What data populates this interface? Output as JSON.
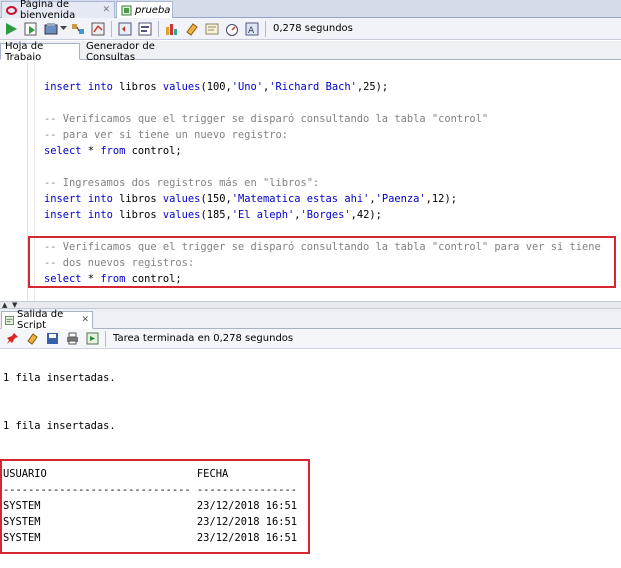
{
  "tabs": [
    {
      "label": "Página de bienvenida"
    },
    {
      "label": "prueba"
    }
  ],
  "toolbar": {
    "elapsed": "0,278 segundos"
  },
  "worksheet_tabs": [
    {
      "label": "Hoja de Trabajo"
    },
    {
      "label": "Generador de Consultas"
    }
  ],
  "editor": {
    "lines": [
      [
        {
          "t": "kw",
          "v": "insert"
        },
        {
          "t": "tx",
          "v": " "
        },
        {
          "t": "kw",
          "v": "into"
        },
        {
          "t": "tx",
          "v": " libros "
        },
        {
          "t": "kw",
          "v": "values"
        },
        {
          "t": "tx",
          "v": "(100,"
        },
        {
          "t": "str",
          "v": "'Uno'"
        },
        {
          "t": "tx",
          "v": ","
        },
        {
          "t": "str",
          "v": "'Richard Bach'"
        },
        {
          "t": "tx",
          "v": ",25);"
        }
      ],
      [
        {
          "t": "cm",
          "v": "-- Verificamos que el trigger se disparó consultando la tabla \"control\""
        }
      ],
      [
        {
          "t": "cm",
          "v": "-- para ver si tiene un nuevo registro:"
        }
      ],
      [
        {
          "t": "kw",
          "v": "select"
        },
        {
          "t": "tx",
          "v": " * "
        },
        {
          "t": "kw",
          "v": "from"
        },
        {
          "t": "tx",
          "v": " control;"
        }
      ],
      [
        {
          "t": "cm",
          "v": "-- Ingresamos dos registros más en \"libros\":"
        }
      ],
      [
        {
          "t": "kw",
          "v": "insert"
        },
        {
          "t": "tx",
          "v": " "
        },
        {
          "t": "kw",
          "v": "into"
        },
        {
          "t": "tx",
          "v": " libros "
        },
        {
          "t": "kw",
          "v": "values"
        },
        {
          "t": "tx",
          "v": "(150,"
        },
        {
          "t": "str",
          "v": "'Matematica estas ahi'"
        },
        {
          "t": "tx",
          "v": ","
        },
        {
          "t": "str",
          "v": "'Paenza'"
        },
        {
          "t": "tx",
          "v": ",12);"
        }
      ],
      [
        {
          "t": "kw",
          "v": "insert"
        },
        {
          "t": "tx",
          "v": " "
        },
        {
          "t": "kw",
          "v": "into"
        },
        {
          "t": "tx",
          "v": " libros "
        },
        {
          "t": "kw",
          "v": "values"
        },
        {
          "t": "tx",
          "v": "(185,"
        },
        {
          "t": "str",
          "v": "'El aleph'"
        },
        {
          "t": "tx",
          "v": ","
        },
        {
          "t": "str",
          "v": "'Borges'"
        },
        {
          "t": "tx",
          "v": ",42);"
        }
      ],
      [
        {
          "t": "cm",
          "v": "-- Verificamos que el trigger se disparó consultando la tabla \"control\" para ver si tiene"
        }
      ],
      [
        {
          "t": "cm",
          "v": "-- dos nuevos registros:"
        }
      ],
      [
        {
          "t": "kw",
          "v": "select"
        },
        {
          "t": "tx",
          "v": " * "
        },
        {
          "t": "kw",
          "v": "from"
        },
        {
          "t": "tx",
          "v": " control;"
        }
      ]
    ]
  },
  "output_panel": {
    "tab_label": "Salida de Script",
    "status": "Tarea terminada en 0,278 segundos",
    "lines": [
      "1 fila insertadas.",
      "1 fila insertadas.",
      "USUARIO                        FECHA",
      "------------------------------ ----------------",
      "SYSTEM                         23/12/2018 16:51",
      "SYSTEM                         23/12/2018 16:51",
      "SYSTEM                         23/12/2018 16:51"
    ]
  },
  "colors": {
    "keyword": "#0000c8",
    "comment": "#828282",
    "highlight": "#d6262f"
  }
}
